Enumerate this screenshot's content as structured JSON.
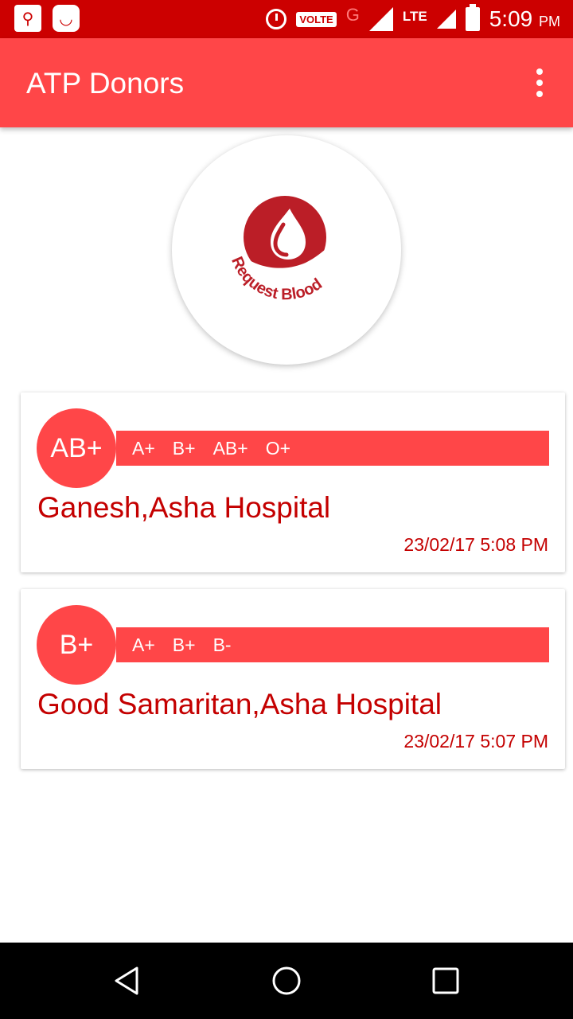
{
  "status_bar": {
    "icons": [
      "usb-icon",
      "android-icon",
      "alarm-icon",
      "volte-badge",
      "g-network-icon",
      "signal-icon",
      "lte-icon",
      "signal-icon-2",
      "battery-icon"
    ],
    "volte": "VOLTE",
    "network": "G",
    "lte": "LTE",
    "time": "5:09",
    "ampm": "PM",
    "background_color": "#cc0000"
  },
  "app_bar": {
    "title": "ATP Donors",
    "menu_icon": "overflow-menu-icon",
    "background_color": "#ff4648"
  },
  "logo": {
    "text": "Request Blood",
    "icon": "blood-drop-hand-icon",
    "color": "#bb1e27"
  },
  "requests": [
    {
      "blood_group": "AB+",
      "compatible": [
        "A+",
        "B+",
        "AB+",
        "O+"
      ],
      "name": "Ganesh,Asha Hospital",
      "timestamp": "23/02/17 5:08 PM"
    },
    {
      "blood_group": "B+",
      "compatible": [
        "A+",
        "B+",
        "B-"
      ],
      "name": "Good Samaritan,Asha Hospital",
      "timestamp": "23/02/17 5:07 PM"
    }
  ],
  "nav_bar": {
    "buttons": [
      "back-icon",
      "home-icon",
      "recents-icon"
    ]
  },
  "colors": {
    "accent": "#ff4648",
    "text_red": "#c40000"
  }
}
